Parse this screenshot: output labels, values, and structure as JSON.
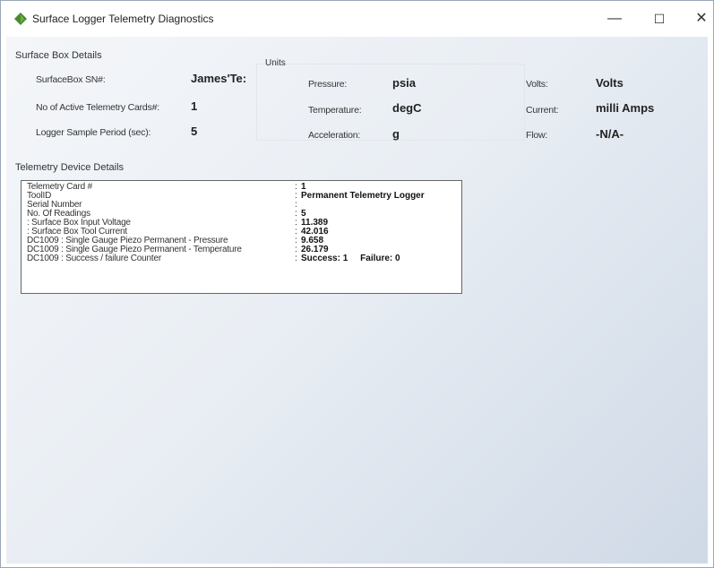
{
  "window": {
    "title": "Surface Logger Telemetry Diagnostics",
    "controls": {
      "minimize": "—",
      "maximize": "☐",
      "close": "✕"
    }
  },
  "surface_box": {
    "group_label": "Surface Box Details",
    "serial_label": "SurfaceBox SN#:",
    "serial_value": "James'Te:",
    "cards_label": "No of Active Telemetry Cards#:",
    "cards_value": "1",
    "period_label": "Logger Sample Period (sec):",
    "period_value": "5"
  },
  "units": {
    "group_label": "Units",
    "pressure_label": "Pressure:",
    "pressure_value": "psia",
    "temperature_label": "Temperature:",
    "temperature_value": "degC",
    "acceleration_label": "Acceleration:",
    "acceleration_value": "g",
    "volts_label": "Volts:",
    "volts_value": "Volts",
    "current_label": "Current:",
    "current_value": "milli Amps",
    "flow_label": "Flow:",
    "flow_value": "-N/A-"
  },
  "telemetry": {
    "group_label": "Telemetry Device Details",
    "rows": [
      {
        "key": "Telemetry Card #",
        "value": "1"
      },
      {
        "key": "ToolID",
        "value": "Permanent Telemetry Logger"
      },
      {
        "key": "Serial Number",
        "value": ""
      },
      {
        "key": "No. Of Readings",
        "value": "5"
      },
      {
        "key": " : Surface Box Input Voltage",
        "value": "11.389"
      },
      {
        "key": " : Surface Box Tool Current",
        "value": "42.016"
      },
      {
        "key": "DC1009 : Single Gauge Piezo Permanent - Pressure",
        "value": "9.658"
      },
      {
        "key": "DC1009 : Single Gauge Piezo Permanent - Temperature",
        "value": "26.179"
      },
      {
        "key": "DC1009 : Success / failure Counter",
        "value": "Success: 1     Failure: 0"
      }
    ]
  },
  "colors": {
    "icon": "#4a8a2e",
    "border": "#666666"
  }
}
